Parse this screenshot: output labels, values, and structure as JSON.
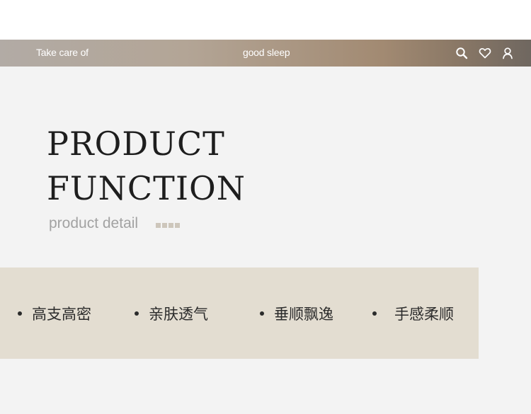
{
  "navbar": {
    "left_text": "Take care of",
    "center_text": "good sleep",
    "icons": [
      "search-icon",
      "heart-icon",
      "user-icon"
    ]
  },
  "hero": {
    "title_line1": "PRODUCT",
    "title_line2": "FUNCTION",
    "subtitle": "product detail"
  },
  "features": [
    {
      "label": "高支高密"
    },
    {
      "label": "亲肤透气"
    },
    {
      "label": "垂顺飘逸"
    },
    {
      "label": "手感柔顺"
    }
  ],
  "colors": {
    "page_background": "#f3f3f3",
    "band_background": "#e3ddd1",
    "title_text": "#1e1e1e",
    "subtitle_text": "#a2a2a2",
    "navbar_gradient_start": "#b2aba5",
    "navbar_gradient_end": "#6f6760"
  }
}
